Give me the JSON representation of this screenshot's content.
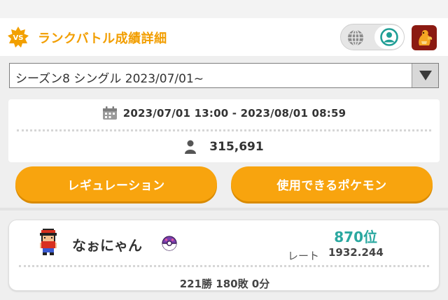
{
  "header": {
    "badge_text": "VS",
    "title": "ランクバトル成績詳細",
    "icons": [
      "vs-badge-icon",
      "globe-icon",
      "user-circle-icon",
      "trainer-avatar-icon"
    ]
  },
  "season_select": {
    "value": "シーズン8 シングル 2023/07/01~",
    "arrow_icon": "triangle-down-icon"
  },
  "season_info": {
    "period": "2023/07/01 13:00 - 2023/08/01 08:59",
    "player_count": "315,691",
    "icons": [
      "calendar-icon",
      "person-icon"
    ]
  },
  "buttons": {
    "regulation": "レギュレーション",
    "usable_pokemon": "使用できるポケモン"
  },
  "player": {
    "name": "なぉにゃん",
    "ball_icon": "master-ball-icon",
    "rank": "870位",
    "rate_label": "レート",
    "rate_value": "1932.244",
    "record": "221勝 180敗 0分"
  },
  "colors": {
    "accent": "#f29e00",
    "button": "#f8a40e",
    "rank": "#2aa8a0",
    "avatar_bg": "#8b1a12"
  }
}
